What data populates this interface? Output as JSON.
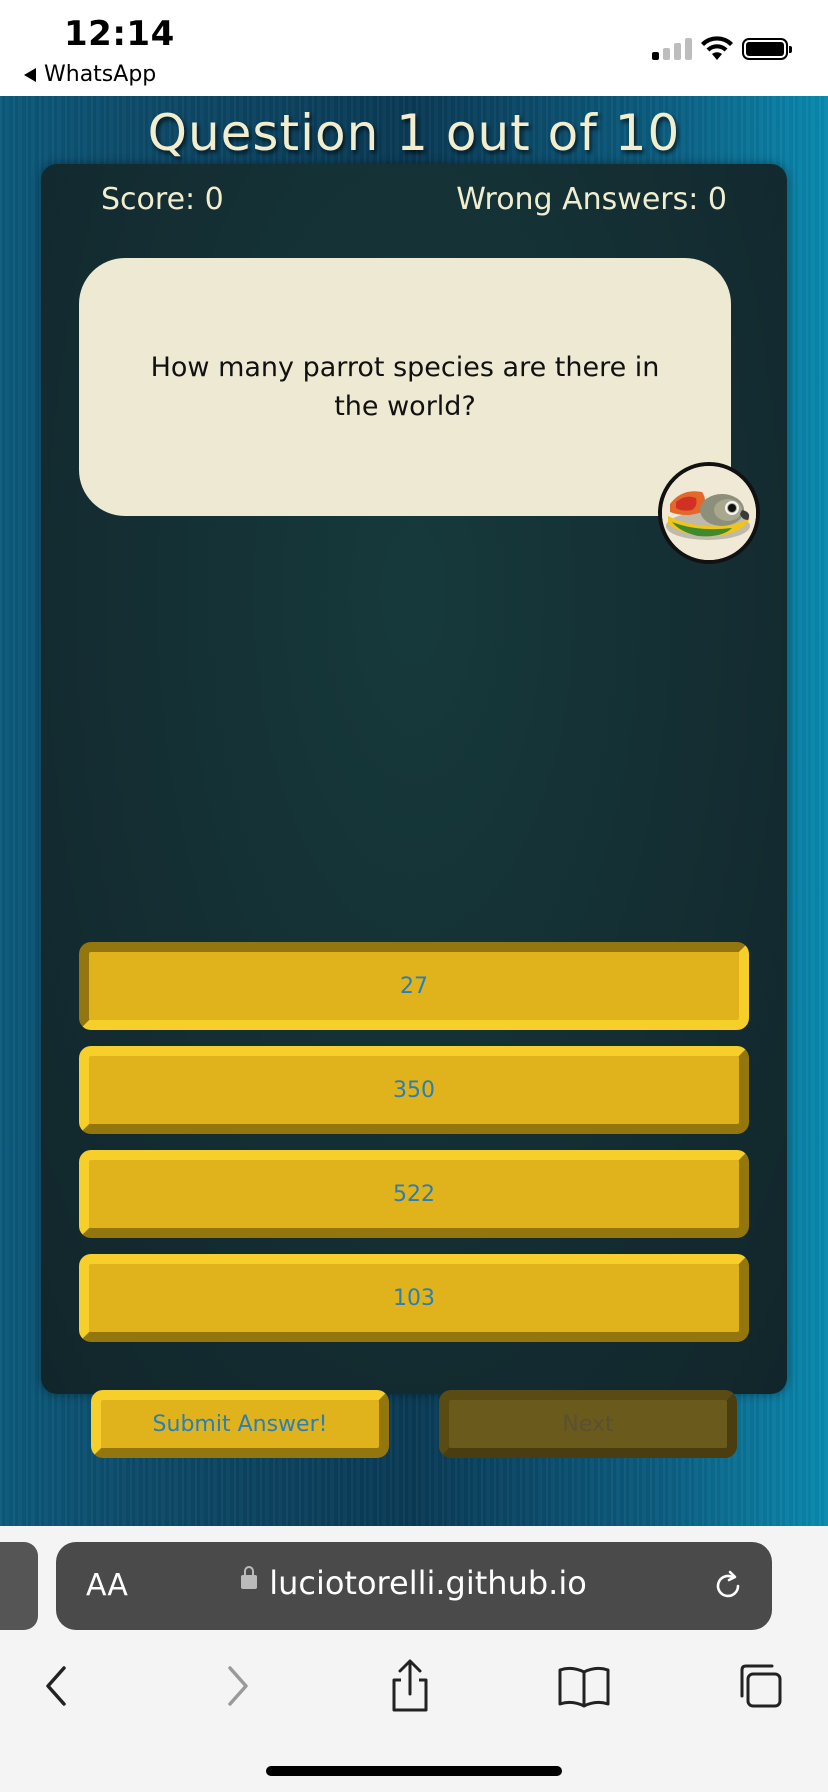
{
  "status_bar": {
    "time": "12:14",
    "back_app": "WhatsApp",
    "signal_icon": "cellular-signal-icon",
    "wifi_icon": "wifi-icon",
    "battery_icon": "battery-icon"
  },
  "quiz": {
    "title": "Question 1 out of 10",
    "score_label": "Score: 0",
    "wrong_label": "Wrong Answers: 0",
    "question": "How many parrot species are there in the world?",
    "image": "parrot-photo",
    "answers": [
      {
        "label": "27"
      },
      {
        "label": "350"
      },
      {
        "label": "522"
      },
      {
        "label": "103"
      }
    ],
    "submit_label": "Submit Answer!",
    "next_label": "Next",
    "colors": {
      "button_fill": "#e0b31c",
      "button_text": "#2a7fb6",
      "panel": "#142e33",
      "title_text": "#f1eecf",
      "bubble": "#ede9d2"
    }
  },
  "browser": {
    "text_size_label": "AA",
    "url": "luciotorelli.github.io",
    "lock_icon": "lock-icon",
    "reload_icon": "reload-icon",
    "toolbar_icons": [
      "back-icon",
      "forward-icon",
      "share-icon",
      "bookmarks-icon",
      "tabs-icon"
    ]
  }
}
